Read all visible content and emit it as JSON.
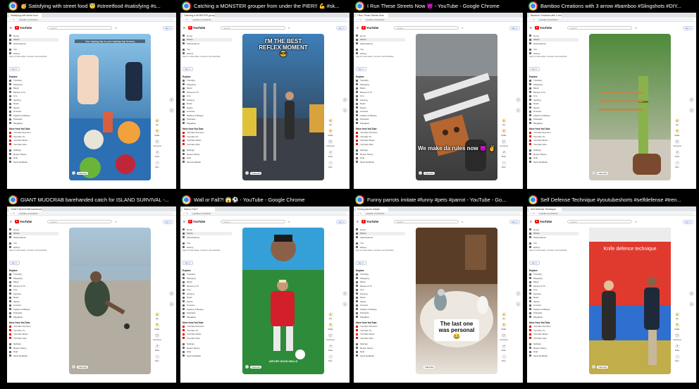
{
  "windows": [
    {
      "title": "🥳 Satisfying with street food 😇 #streetfood #satisfying #s...",
      "tab_label": "Satisfying with street food",
      "url": "youtube.com/shorts",
      "overlay_text": "You saying tap to you saying tap tearmy",
      "overlay_style": "top-strip",
      "colors": {
        "top": "#8cc4e8",
        "bottom": "#1a5a96",
        "accent": "#e85d34"
      },
      "scene": "street-food"
    },
    {
      "title": "Catching a MONSTER grouper from under the PIER!! 💪 #sk...",
      "tab_label": "Catching a MONSTER grouper",
      "url": "youtube.com/shorts",
      "overlay_text": "I'M THE BEST REFLEX MOMENT 😎",
      "overlay_style": "big-top",
      "colors": {
        "top": "#3e7fb8",
        "bottom": "#2b2d35",
        "accent": "#f1c40f"
      },
      "scene": "pier"
    },
    {
      "title": "I Run These Streets Now 😈 - YouTube - Google Chrome",
      "tab_label": "I Run These Streets Now",
      "url": "youtube.com/shorts",
      "overlay_text": "We make da rules now 😈 ✌",
      "overlay_style": "bottom-big",
      "colors": {
        "top": "#6d6d6d",
        "bottom": "#3a3a3a",
        "accent": "#b5652f"
      },
      "scene": "street"
    },
    {
      "title": "Bamboo Creations with 3 arrow #bamboo #Slingshots #DIY...",
      "tab_label": "Bamboo Creations with 3 arrow",
      "url": "youtube.com/shorts",
      "overlay_text": "",
      "overlay_style": "none",
      "colors": {
        "top": "#4e8a3a",
        "bottom": "#c9c3b6",
        "accent": "#8ab24a"
      },
      "scene": "bamboo"
    },
    {
      "title": "GIANT MUDCRAB barehanded catch for ISLAND SURVIVAL -...",
      "tab_label": "GIANT MUDCRAB barehanded",
      "url": "youtube.com/shorts",
      "overlay_text": "",
      "overlay_style": "none",
      "colors": {
        "top": "#a9c6da",
        "bottom": "#8f8a7c",
        "accent": "#3a4a3a"
      },
      "scene": "beach"
    },
    {
      "title": "Wall or Fall?! 😱⚽ - YouTube - Google Chrome",
      "tab_label": "Wall or Fall?!",
      "url": "youtube.com/shorts",
      "overlay_text": "ARTURY GOOD SKILLS",
      "overlay_style": "bottom-small",
      "colors": {
        "top": "#2f9fd6",
        "bottom": "#2e8b3a",
        "accent": "#d21f2b"
      },
      "scene": "football"
    },
    {
      "title": "Funny parrots imitate #funny #pets #parrot - YouTube - Go...",
      "tab_label": "Funny parrots imitate",
      "url": "youtube.com/shorts",
      "overlay_text": "The last one was personal 😂",
      "overlay_style": "middle-box",
      "colors": {
        "top": "#6b4a2e",
        "bottom": "#e9e4dc",
        "accent": "#8a9aa0"
      },
      "scene": "parrots"
    },
    {
      "title": "Self Defense Technique #youtubeshorts #selfdefense #tren...",
      "tab_label": "Self Defense Technique",
      "url": "youtube.com/shorts",
      "overlay_text": "Knife defence technique",
      "overlay_style": "top-banner",
      "colors": {
        "top": "#e03a2f",
        "bottom": "#2f6fd0",
        "accent": "#f3c11c"
      },
      "scene": "gym"
    }
  ],
  "youtube": {
    "logo": "YouTube",
    "search_placeholder": "Search",
    "sign_in": "Sign in",
    "sidebar_top": [
      "Home",
      "Shorts",
      "Subscriptions"
    ],
    "sidebar_you": [
      "You",
      "History"
    ],
    "signin_note": "Sign in to like videos, comment, and subscribe.",
    "explore_heading": "Explore",
    "explore": [
      "Trending",
      "Shopping",
      "Music",
      "Movies & TV",
      "Live",
      "Gaming",
      "News",
      "Sports",
      "Courses",
      "Fashion & Beauty",
      "Podcasts",
      "Playables"
    ],
    "more_heading": "More from YouTube",
    "more": [
      "YouTube Premium",
      "YouTube TV",
      "YouTube Music",
      "YouTube Kids"
    ],
    "bottom": [
      "Settings",
      "Report history",
      "Help",
      "Send feedback"
    ],
    "actions": [
      "👍",
      "👎",
      "💬",
      "↗",
      "⋯"
    ],
    "action_labels": [
      "Like",
      "Dislike",
      "Comments",
      "Share",
      "More"
    ],
    "subscribe": "Subscribe"
  }
}
